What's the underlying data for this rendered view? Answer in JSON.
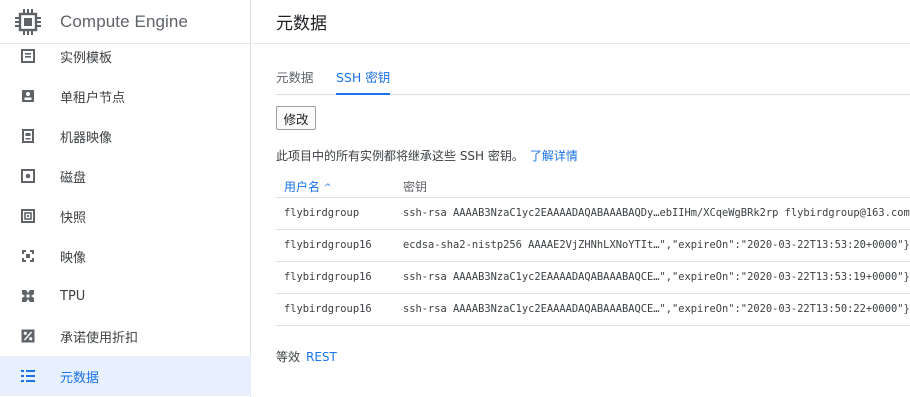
{
  "sidebar": {
    "title": "Compute Engine",
    "items": [
      {
        "label": "实例模板",
        "icon": "instance-template-icon"
      },
      {
        "label": "单租户节点",
        "icon": "sole-tenant-node-icon"
      },
      {
        "label": "机器映像",
        "icon": "machine-image-icon"
      },
      {
        "label": "磁盘",
        "icon": "disk-icon"
      },
      {
        "label": "快照",
        "icon": "snapshot-icon"
      },
      {
        "label": "映像",
        "icon": "image-icon"
      },
      {
        "label": "TPU",
        "icon": "tpu-icon"
      },
      {
        "label": "承诺使用折扣",
        "icon": "percent-icon"
      },
      {
        "label": "元数据",
        "icon": "metadata-list-icon",
        "active": true
      }
    ]
  },
  "header": {
    "title": "元数据"
  },
  "tabs": [
    {
      "label": "元数据",
      "active": false
    },
    {
      "label": "SSH 密钥",
      "active": true
    }
  ],
  "edit_button": "修改",
  "description": {
    "text": "此项目中的所有实例都将继承这些 SSH 密钥。",
    "link": "了解详情"
  },
  "table": {
    "columns": [
      "用户名",
      "密钥"
    ],
    "sort_indicator": "^",
    "rows": [
      {
        "user": "flybirdgroup",
        "key": "ssh-rsa AAAAB3NzaC1yc2EAAAADAQABAAABAQDy…ebIIHm/XCqeWgBRk2rp flybirdgroup@163.com"
      },
      {
        "user": "flybirdgroup16",
        "key": "ecdsa-sha2-nistp256 AAAAE2VjZHNhLXNoYTIt…\",\"expireOn\":\"2020-03-22T13:53:20+0000\"}"
      },
      {
        "user": "flybirdgroup16",
        "key": "ssh-rsa AAAAB3NzaC1yc2EAAAADAQABAAABAQCE…\",\"expireOn\":\"2020-03-22T13:53:19+0000\"}"
      },
      {
        "user": "flybirdgroup16",
        "key": "ssh-rsa AAAAB3NzaC1yc2EAAAADAQABAAABAQCE…\",\"expireOn\":\"2020-03-22T13:50:22+0000\"}"
      }
    ]
  },
  "etag": {
    "label": "等效",
    "value": "REST"
  },
  "colors": {
    "accent": "#1a73e8",
    "active_bg": "#e8f0fe",
    "icon": "#5f6368"
  }
}
